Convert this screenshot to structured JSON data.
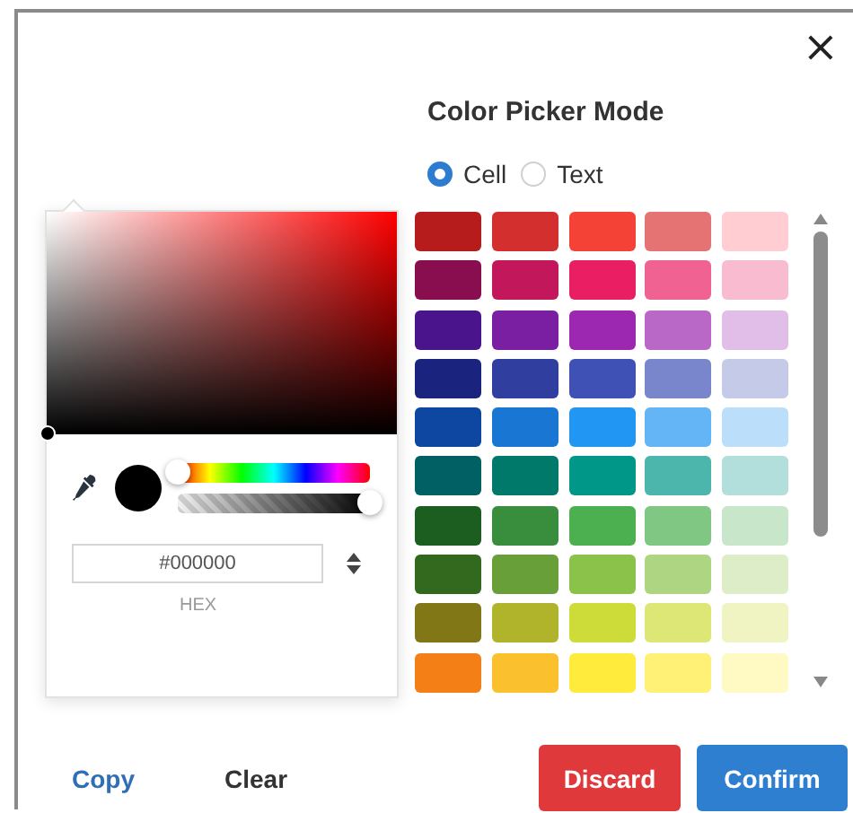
{
  "dialog": {
    "close_label": "×",
    "title": "Color Picker Mode"
  },
  "modes": [
    {
      "label": "Cell",
      "selected": true
    },
    {
      "label": "Text",
      "selected": false
    }
  ],
  "picker": {
    "hue": {
      "level": 0
    },
    "alpha": {
      "level": 1
    },
    "hex_value": "#000000",
    "hex_label": "HEX"
  },
  "swatches": [
    {
      "cells": [
        {
          "color": "#b71c1c"
        },
        {
          "color": "#d32f2f"
        },
        {
          "color": "#f44336"
        },
        {
          "color": "#e57373"
        },
        {
          "color": "#ffcdd2"
        }
      ]
    },
    {
      "cells": [
        {
          "color": "#880e4f"
        },
        {
          "color": "#c2185b"
        },
        {
          "color": "#e91e63"
        },
        {
          "color": "#f06292"
        },
        {
          "color": "#f8bbd0"
        }
      ]
    },
    {
      "cells": [
        {
          "color": "#4a148c"
        },
        {
          "color": "#7b1fa2"
        },
        {
          "color": "#9c27b0"
        },
        {
          "color": "#ba68c8"
        },
        {
          "color": "#e1bee7"
        }
      ]
    },
    {
      "cells": [
        {
          "color": "#1a237e"
        },
        {
          "color": "#303f9f"
        },
        {
          "color": "#3f51b5"
        },
        {
          "color": "#7986cb"
        },
        {
          "color": "#c5cae9"
        }
      ]
    },
    {
      "cells": [
        {
          "color": "#0d47a1"
        },
        {
          "color": "#1976d2"
        },
        {
          "color": "#2196f3"
        },
        {
          "color": "#64b5f6"
        },
        {
          "color": "#bbdefb"
        }
      ]
    },
    {
      "cells": [
        {
          "color": "#006064"
        },
        {
          "color": "#00796b"
        },
        {
          "color": "#009688"
        },
        {
          "color": "#4db6ac"
        },
        {
          "color": "#b2dfdb"
        }
      ]
    },
    {
      "cells": [
        {
          "color": "#1b5e20"
        },
        {
          "color": "#388e3c"
        },
        {
          "color": "#4caf50"
        },
        {
          "color": "#81c784"
        },
        {
          "color": "#c8e6c9"
        }
      ]
    },
    {
      "cells": [
        {
          "color": "#33691e"
        },
        {
          "color": "#689f38"
        },
        {
          "color": "#8bc34a"
        },
        {
          "color": "#aed581"
        },
        {
          "color": "#dcedc8"
        }
      ]
    },
    {
      "cells": [
        {
          "color": "#827717"
        },
        {
          "color": "#afb42b"
        },
        {
          "color": "#cddc39"
        },
        {
          "color": "#dce775"
        },
        {
          "color": "#f0f4c3"
        }
      ]
    },
    {
      "cells": [
        {
          "color": "#f57f17"
        },
        {
          "color": "#fbc02d"
        },
        {
          "color": "#ffeb3b"
        },
        {
          "color": "#fff176"
        },
        {
          "color": "#fff9c4"
        }
      ]
    }
  ],
  "buttons": [
    {
      "label": "Copy",
      "kind": "link"
    },
    {
      "label": "Clear",
      "kind": "plain"
    },
    {
      "label": "Discard",
      "kind": "danger"
    },
    {
      "label": "Confirm",
      "kind": "primary"
    }
  ]
}
